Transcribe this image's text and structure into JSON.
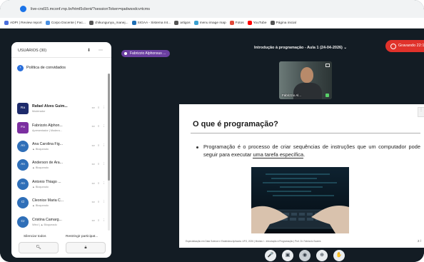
{
  "browser": {
    "url": "live-cnd15.mconf.rnp.br/html5client/?sessionToken=qadwsxdcvrtcms",
    "bookmarks": [
      {
        "label": "ADPI | Review report",
        "color": "#4a6fdc"
      },
      {
        "label": "Corpo Docente | Fac...",
        "color": "#4a90e2"
      },
      {
        "label": "chikungunya_manej...",
        "color": "#555555"
      },
      {
        "label": "SIGAA - Sistema Int...",
        "color": "#1f6fb5"
      },
      {
        "label": "artigos",
        "color": "#555555"
      },
      {
        "label": "menu image map",
        "color": "#3aa0d0"
      },
      {
        "label": "Fotos",
        "color": "#e04a3a"
      },
      {
        "label": "YouTube",
        "color": "#ff0000"
      },
      {
        "label": "Página inicial",
        "color": "#555555"
      }
    ]
  },
  "sidebar": {
    "title": "USUÁRIOS (30)",
    "guest_policy": "Política de convidados",
    "participants": [
      {
        "initials": "Ra",
        "name": "Rafael Alves Guim...",
        "role": "Moderador",
        "color": "#1d2a6b",
        "square": true,
        "bold": true
      },
      {
        "initials": "Fa",
        "name": "Fabrizzio Alphon...",
        "role": "Apresentador | Modera...",
        "color": "#7b2fa0",
        "square": true,
        "bold": false
      },
      {
        "initials": "An",
        "name": "Ana Carolina Fig...",
        "role": "▲ Bloqueado",
        "color": "#2f6fb8",
        "square": false,
        "bold": false
      },
      {
        "initials": "An",
        "name": "Anderson de Ara...",
        "role": "▲ Bloqueado",
        "color": "#2f6fb8",
        "square": false,
        "bold": false
      },
      {
        "initials": "An",
        "name": "Antonio Thiago ...",
        "role": "▲ Bloqueado",
        "color": "#2f6fb8",
        "square": false,
        "bold": false
      },
      {
        "initials": "Cl",
        "name": "Cleonice Maria C...",
        "role": "▲ Bloqueado",
        "color": "#2f6fb8",
        "square": false,
        "bold": false
      },
      {
        "initials": "Cr",
        "name": "Cristina Camarg...",
        "role": "Wind | ▲ Bloqueado",
        "color": "#2f6fb8",
        "square": false,
        "bold": false
      },
      {
        "initials": "Da",
        "name": "Danilo Barros M...",
        "role": "▲ Bloqueado",
        "color": "#2f6fb8",
        "square": false,
        "bold": false
      }
    ],
    "mute_all": "Silenciar todos",
    "restrict": "Restringir participat..."
  },
  "topbar": {
    "presenter": "Fabrizzio Alphonsus ...",
    "meeting_title": "Introdução à programação - Aula 1 (24-04-2026)  ⌄",
    "record_label": "Gravando 22:1"
  },
  "webcam": {
    "name": "Fabrizzio Al..."
  },
  "slide": {
    "title": "O que é programação?",
    "bullet_a": "Programação é o processo de criar sequências de instruções que um computador pode seguir para executar ",
    "bullet_u": "uma tarefa específica",
    "bullet_b": ".",
    "footer": "Especialização em Data Science e Estatística Aplicada. UFG, 2026   |   Módulo I - Introdução à Programação   |   Prof. Dr. Fabrizzio Soares",
    "page": "2 /"
  },
  "controls": [
    "🎤",
    "▣",
    "◉",
    "⊕",
    "✋"
  ]
}
